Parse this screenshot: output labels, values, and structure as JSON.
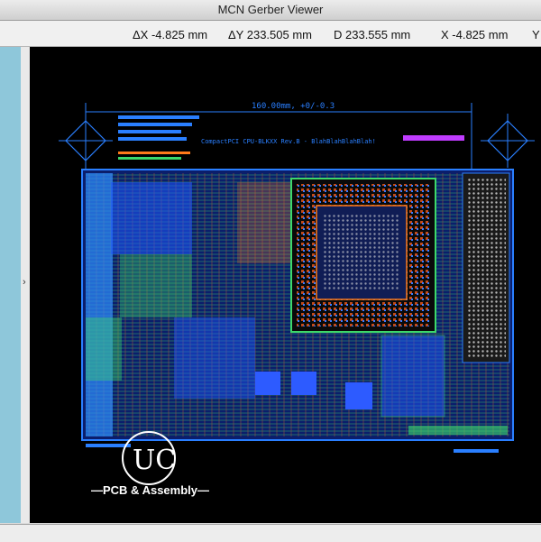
{
  "window": {
    "title": "MCN Gerber Viewer"
  },
  "readout": {
    "dx": "ΔX -4.825 mm",
    "dy": "ΔY 233.505 mm",
    "d": "D 233.555 mm",
    "x": "X -4.825 mm",
    "y": "Y"
  },
  "drawing": {
    "dimension_label": "160.00mm, +0/-0.3",
    "title_line": "CompactPCI  CPU-BLKXX  Rev.B  -  BlahBlahBlahBlah!"
  },
  "watermark": {
    "logo_text": "UC",
    "tagline": "—PCB & Assembly—"
  },
  "colors": {
    "canvas": "#000000",
    "board_outline": "#2a7fff",
    "copper_blue": "#1f57ff",
    "trace_green": "#3dd86a",
    "trace_orange": "#ff7a1a",
    "silk_yellow": "#e8d64a",
    "sidepanel": "#8ec7da"
  },
  "icons": {
    "gutter": "chevron-icon"
  }
}
